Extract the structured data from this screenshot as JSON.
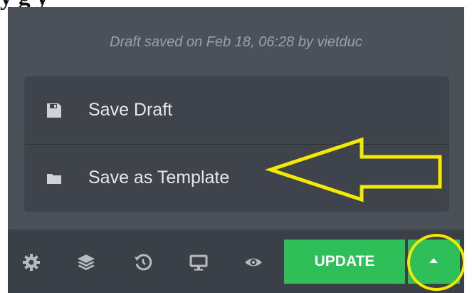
{
  "page": {
    "cropped_heading": "y                  g         y",
    "saved_note": "Draft saved on Feb 18, 06:28 by vietduc"
  },
  "menu": {
    "items": [
      {
        "label": "Save Draft",
        "icon": "floppy-disk-icon"
      },
      {
        "label": "Save as Template",
        "icon": "folder-icon"
      }
    ]
  },
  "toolbar": {
    "icons": [
      "gear-icon",
      "layers-icon",
      "history-icon",
      "monitor-icon",
      "eye-icon"
    ],
    "update_label": "UPDATE",
    "caret_icon": "caret-up-icon"
  },
  "annotations": {
    "arrow_color": "#f5e900",
    "circle_color": "#f5e900"
  },
  "colors": {
    "panel": "#4b5157",
    "menu": "#3e444a",
    "bottom_bar": "#3b4046",
    "accent_green": "#2ebf58"
  }
}
